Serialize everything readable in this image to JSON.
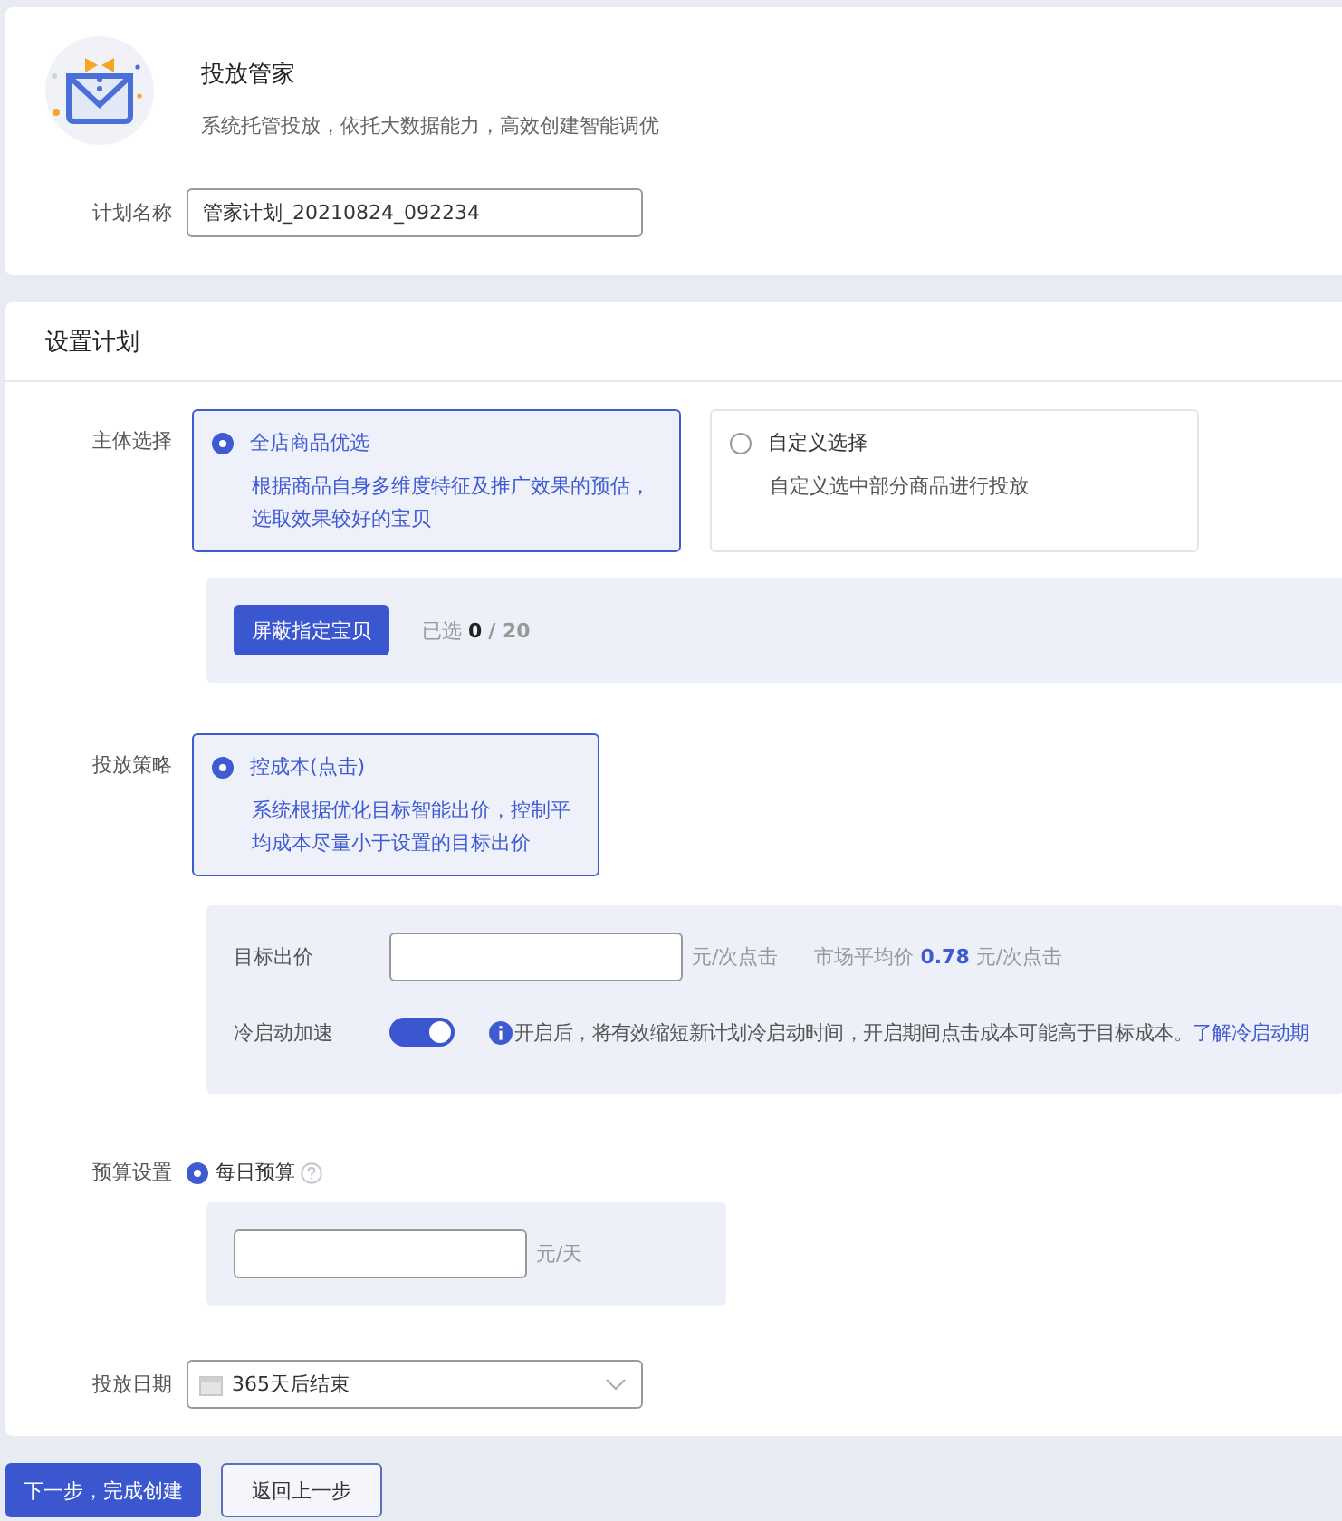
{
  "header": {
    "title": "投放管家",
    "subtitle": "系统托管投放，依托大数据能力，高效创建智能调优"
  },
  "plan_name": {
    "label": "计划名称",
    "value": "管家计划_20210824_092234"
  },
  "section": {
    "title": "设置计划"
  },
  "subject": {
    "label": "主体选择",
    "options": [
      {
        "title": "全店商品优选",
        "description": "根据商品自身多维度特征及推广效果的预估，选取效果较好的宝贝",
        "selected": true
      },
      {
        "title": "自定义选择",
        "description": "自定义选中部分商品进行投放",
        "selected": false
      }
    ],
    "exclude_button": "屏蔽指定宝贝",
    "selected_count": "已选 **0** **/ 20**"
  },
  "strategy": {
    "label": "投放策略",
    "options": [
      {
        "title": "控成本(点击)",
        "description": "系统根据优化目标智能出价，控制平均成本尽量小于设置的目标出价",
        "selected": true
      }
    ],
    "target_bid": {
      "label": "目标出价",
      "unit": "元/次点击"
    },
    "market_avg": "市场平均价 **0.78** 元/次点击",
    "cold_start": {
      "label": "冷启动加速",
      "on": true,
      "notice": "开启后，将有效缩短新计划冷启动时间，开启期间点击成本可能高于目标成本。",
      "link": "了解冷启动期"
    }
  },
  "budget": {
    "label": "预算设置",
    "option": {
      "label": "每日预算",
      "selected": true
    },
    "unit": "元/天"
  },
  "schedule": {
    "label": "投放日期",
    "value": "365天后结束"
  },
  "buttons": [
    {
      "label": "下一步，完成创建",
      "kind": "primary"
    },
    {
      "label": "返回上一步",
      "kind": "secondary"
    }
  ]
}
